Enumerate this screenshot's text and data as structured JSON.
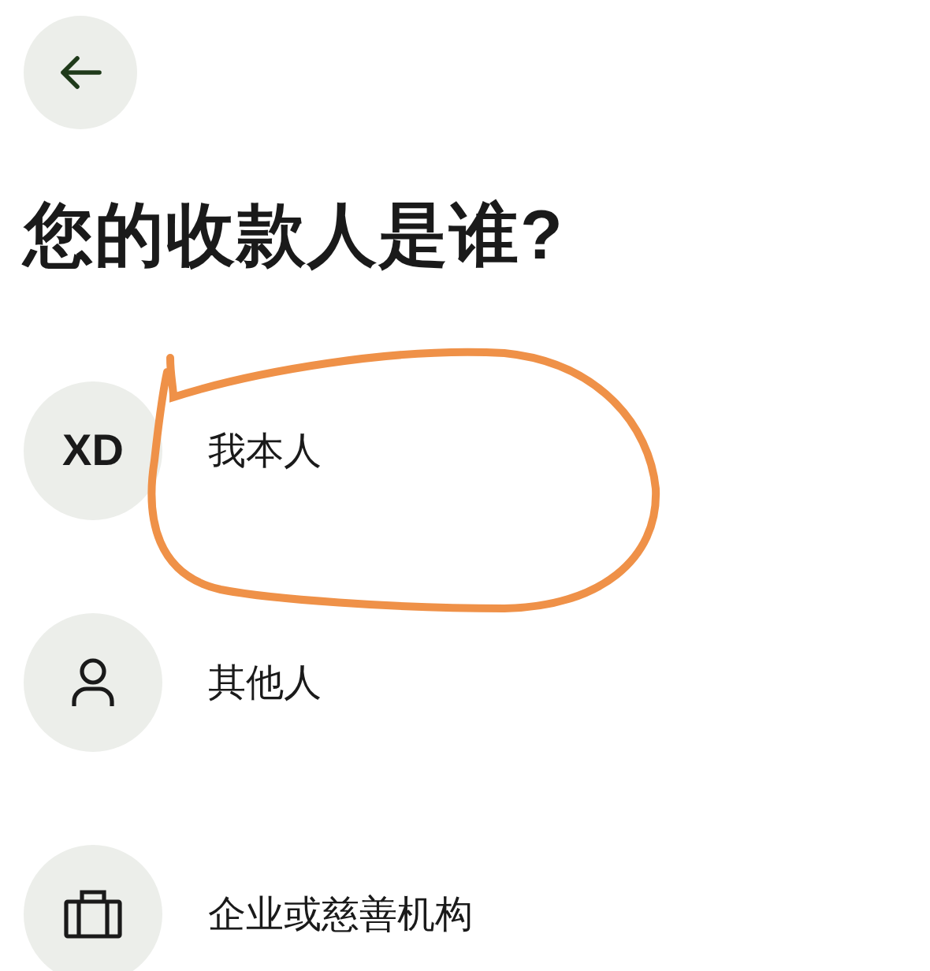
{
  "title": "您的收款人是谁?",
  "options": [
    {
      "kind": "initials",
      "avatar": "XD",
      "label": "我本人"
    },
    {
      "kind": "person",
      "label": "其他人"
    },
    {
      "kind": "briefcase",
      "label": "企业或慈善机构"
    }
  ]
}
